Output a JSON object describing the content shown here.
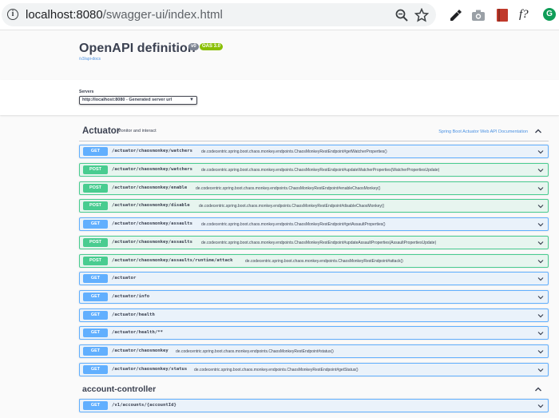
{
  "browser": {
    "url_host": "localhost:8080",
    "url_path": "/swagger-ui/index.html",
    "ext_f_label": "f?",
    "ext_g_label": "G"
  },
  "info": {
    "title": "OpenAPI definition",
    "version_badge": "v0",
    "oas_badge": "OAS 3.0",
    "docs_link": "/v3/api-docs"
  },
  "servers": {
    "label": "Servers",
    "selected": "http://localhost:8080 - Generated server url"
  },
  "tags": [
    {
      "name": "Actuator",
      "description": "Monitor and interact",
      "external_link": "Spring Boot Actuator Web API Documentation"
    },
    {
      "name": "account-controller",
      "description": "",
      "external_link": ""
    }
  ],
  "operations": [
    {
      "method": "GET",
      "path": "/actuator/chaosmonkey/watchers",
      "summary": "de.codecentric.spring.boot.chaos.monkey.endpoints.ChaosMonkeyRestEndpoint#getWatcherProperties()"
    },
    {
      "method": "POST",
      "path": "/actuator/chaosmonkey/watchers",
      "summary": "de.codecentric.spring.boot.chaos.monkey.endpoints.ChaosMonkeyRestEndpoint#updateWatcherProperties(WatcherPropertiesUpdate)"
    },
    {
      "method": "POST",
      "path": "/actuator/chaosmonkey/enable",
      "summary": "de.codecentric.spring.boot.chaos.monkey.endpoints.ChaosMonkeyRestEndpoint#enableChaosMonkey()"
    },
    {
      "method": "POST",
      "path": "/actuator/chaosmonkey/disable",
      "summary": "de.codecentric.spring.boot.chaos.monkey.endpoints.ChaosMonkeyRestEndpoint#disableChaosMonkey()"
    },
    {
      "method": "GET",
      "path": "/actuator/chaosmonkey/assaults",
      "summary": "de.codecentric.spring.boot.chaos.monkey.endpoints.ChaosMonkeyRestEndpoint#getAssaultProperties()"
    },
    {
      "method": "POST",
      "path": "/actuator/chaosmonkey/assaults",
      "summary": "de.codecentric.spring.boot.chaos.monkey.endpoints.ChaosMonkeyRestEndpoint#updateAssaultProperties(AssaultPropertiesUpdate)"
    },
    {
      "method": "POST",
      "path": "/actuator/chaosmonkey/assaults/runtime/attack",
      "summary": "de.codecentric.spring.boot.chaos.monkey.endpoints.ChaosMonkeyRestEndpoint#attack()"
    },
    {
      "method": "GET",
      "path": "/actuator",
      "summary": ""
    },
    {
      "method": "GET",
      "path": "/actuator/info",
      "summary": ""
    },
    {
      "method": "GET",
      "path": "/actuator/health",
      "summary": ""
    },
    {
      "method": "GET",
      "path": "/actuator/health/**",
      "summary": ""
    },
    {
      "method": "GET",
      "path": "/actuator/chaosmonkey",
      "summary": "de.codecentric.spring.boot.chaos.monkey.endpoints.ChaosMonkeyRestEndpoint#status()"
    },
    {
      "method": "GET",
      "path": "/actuator/chaosmonkey/status",
      "summary": "de.codecentric.spring.boot.chaos.monkey.endpoints.ChaosMonkeyRestEndpoint#getStatus()"
    },
    {
      "method": "GET",
      "path": "/v1/accounts/{accountId}",
      "summary": ""
    }
  ],
  "colors": {
    "get": "#61affe",
    "post": "#49cc90",
    "text": "#3b4151",
    "link": "#4990e2"
  }
}
